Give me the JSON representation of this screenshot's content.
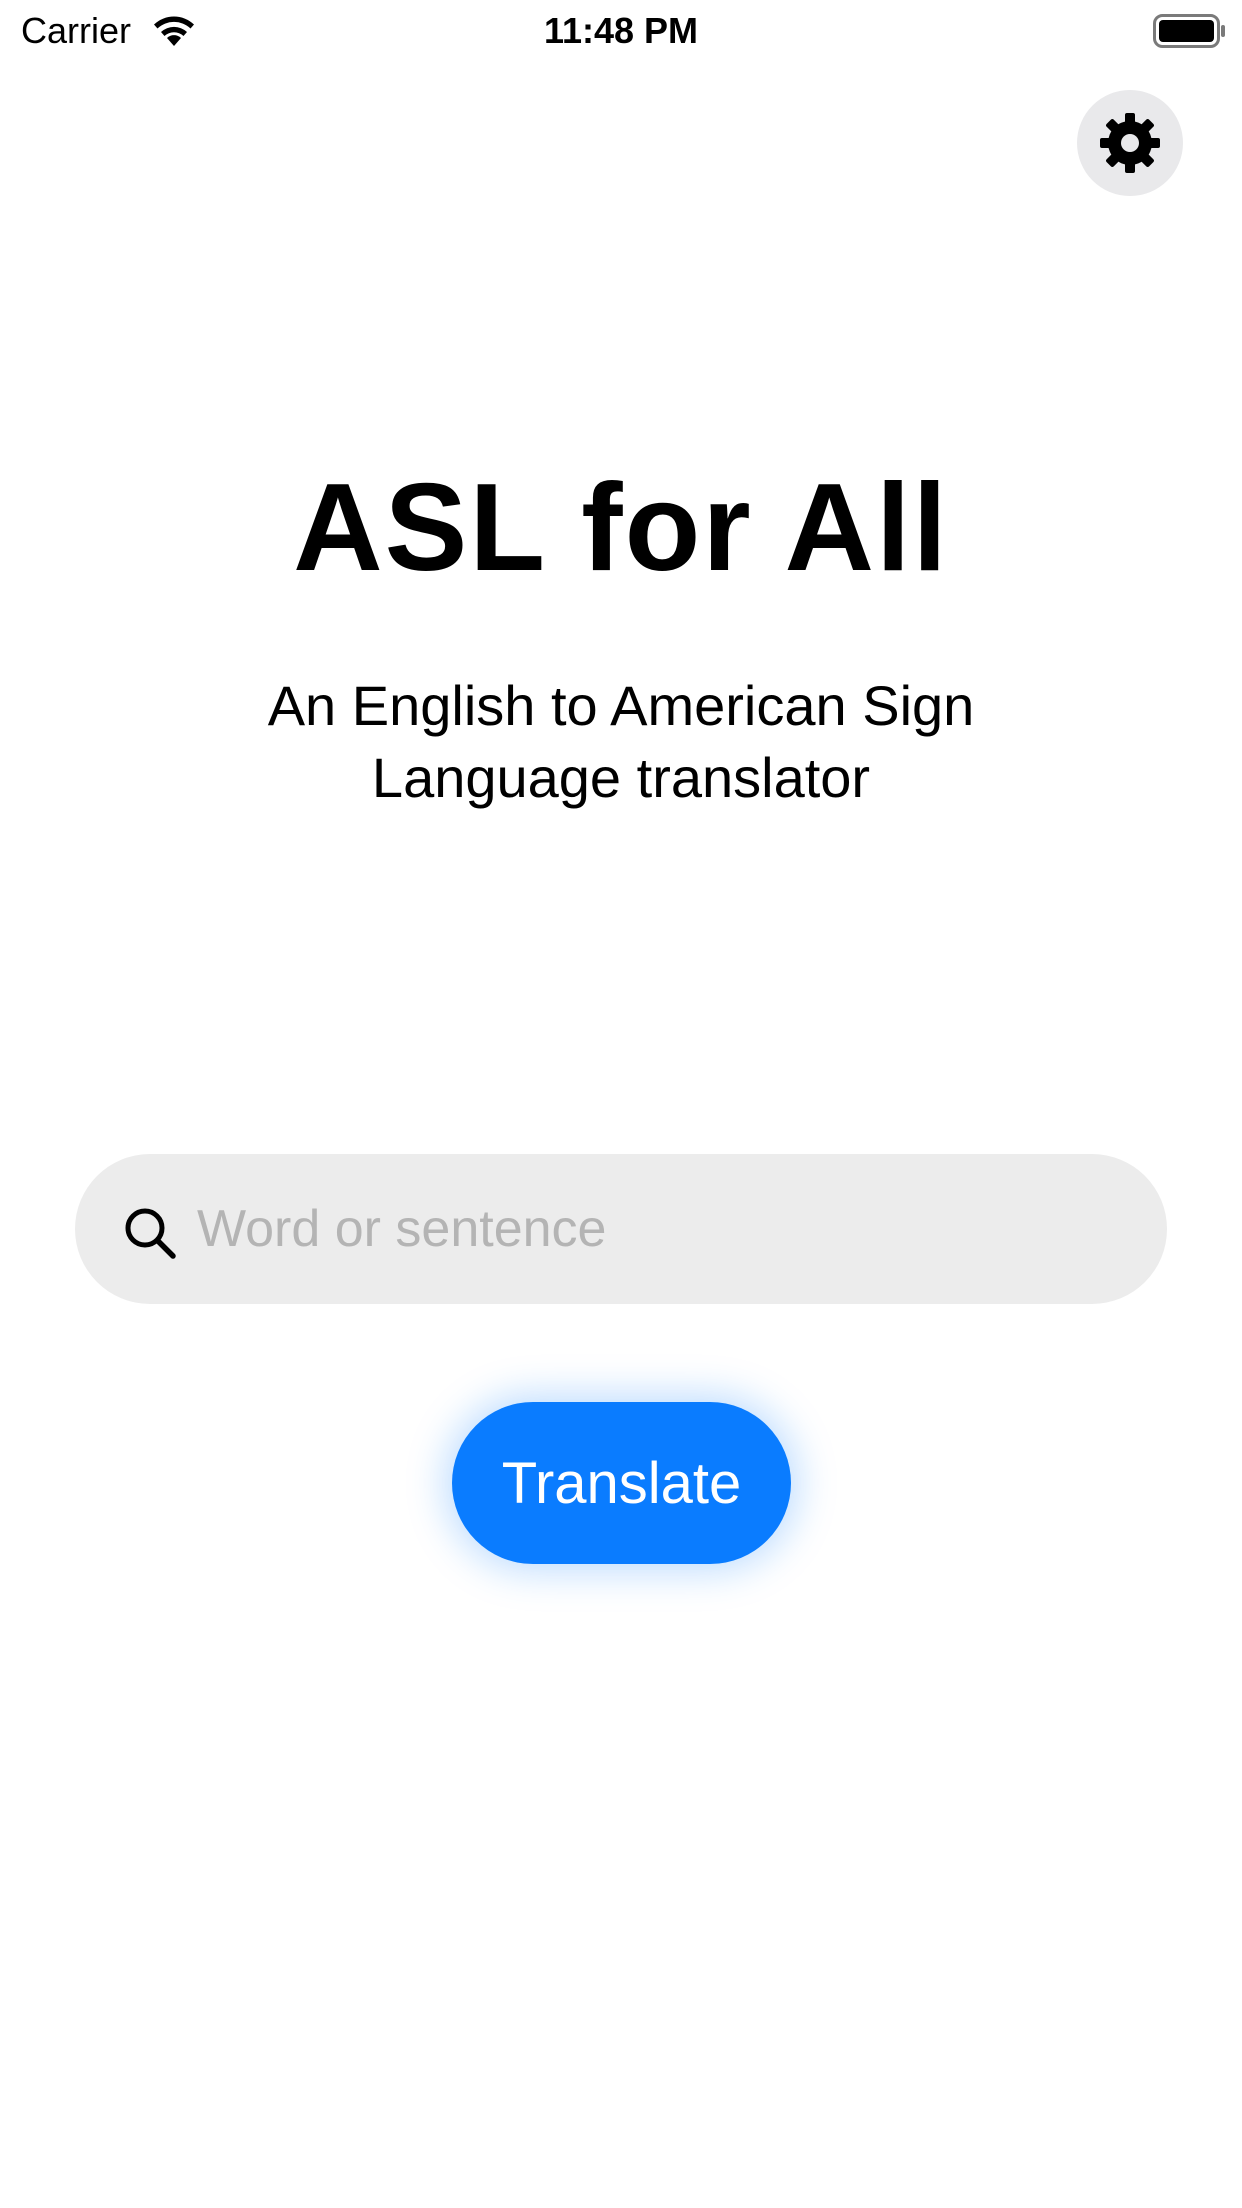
{
  "status_bar": {
    "carrier": "Carrier",
    "time": "11:48 PM",
    "wifi_icon": "wifi-icon",
    "battery_icon": "battery-icon"
  },
  "header": {
    "settings_icon": "gear-icon"
  },
  "main": {
    "title": "ASL for All",
    "subtitle": "An English to American Sign Language translator",
    "search": {
      "icon": "search-icon",
      "value": "",
      "placeholder": "Word or sentence"
    },
    "translate_label": "Translate"
  },
  "colors": {
    "accent": "#0a7cff",
    "field_background": "#ececec",
    "settings_background": "#e9e9eb",
    "placeholder": "#b4b4b4"
  }
}
